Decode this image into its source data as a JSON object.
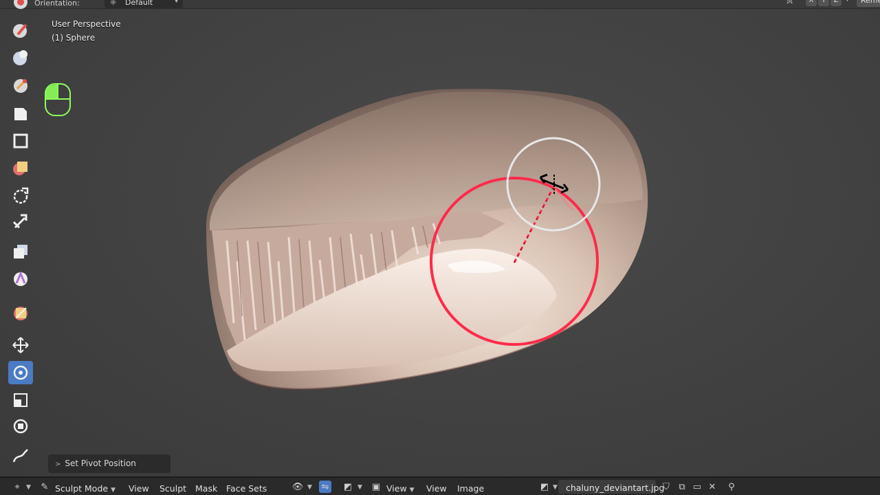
{
  "header": {
    "orientation_label": "Orientation:",
    "orientation_value": "Default",
    "axis_x": "X",
    "axis_y": "Y",
    "axis_z": "Z",
    "remesh_label": "Reme"
  },
  "viewport": {
    "perspective": "User Perspective",
    "object": "(1) Sphere"
  },
  "toolbar": {
    "tools": [
      {
        "icon": "draw-brush-icon"
      },
      {
        "icon": "clay-brush-icon"
      },
      {
        "icon": "layer-brush-icon"
      },
      {
        "icon": "inflate-brush-icon"
      },
      {
        "icon": "blob-brush-icon"
      },
      {
        "icon": "crease-brush-icon"
      },
      {
        "icon": "smooth-brush-icon"
      },
      {
        "icon": "flatten-brush-icon"
      },
      {
        "icon": "grab-brush-icon"
      },
      {
        "icon": "snake-hook-brush-icon"
      },
      {
        "icon": "mask-brush-icon"
      },
      {
        "icon": "face-set-icon"
      },
      {
        "icon": "paint-brush-icon"
      },
      {
        "icon": "move-icon"
      },
      {
        "icon": "rotate-icon",
        "active": true
      },
      {
        "icon": "scale-icon"
      },
      {
        "icon": "transform-icon"
      },
      {
        "icon": "annotate-icon"
      }
    ],
    "accent_color": "#4a7bc4"
  },
  "last_operation": {
    "label": "Set Pivot Position"
  },
  "bottom_bar": {
    "mode": "Sculpt Mode",
    "menu_view": "View",
    "menu_sculpt": "Sculpt",
    "menu_mask": "Mask",
    "menu_face_sets": "Face Sets",
    "image_view": "View",
    "image_menu_view": "View",
    "image_menu_image": "Image",
    "image_file": "chaluny_deviantart.jpg"
  },
  "colors": {
    "brush_cursor": "#ff2a4a",
    "pivot_cursor": "#e8e8e8",
    "mouse_indicator": "#8cff5a"
  }
}
